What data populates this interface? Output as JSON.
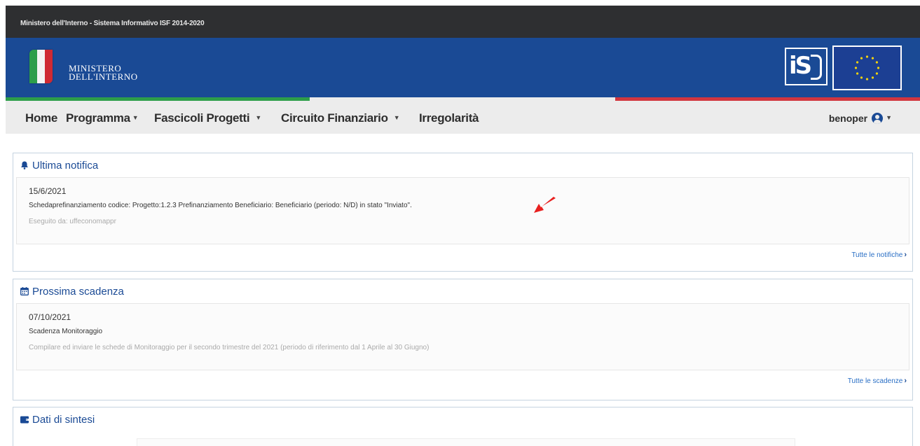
{
  "topbar": {
    "title": "Ministero dell'Interno - Sistema Informativo ISF 2014-2020"
  },
  "header": {
    "ministry_line1": "MINISTERO",
    "ministry_line2": "DELL'INTERNO",
    "isf_logo_text": "iS"
  },
  "nav": {
    "items": [
      "Home",
      "Programma",
      "Fascicoli",
      "Progetti",
      "Circuito Finanziario",
      "Irregolarità"
    ],
    "user": "benoper"
  },
  "cards": {
    "notifica": {
      "title": "Ultima notifica",
      "date": "15/6/2021",
      "text": "Schedaprefinanziamento codice: Progetto:1.2.3 Prefinanziamento Beneficiario: Beneficiario (periodo: N/D) in stato \"Inviato\".",
      "sub": "Eseguito da: uffeconomappr",
      "link": "Tutte le notifiche"
    },
    "scadenza": {
      "title": "Prossima scadenza",
      "date": "07/10/2021",
      "text": "Scadenza Monitoraggio",
      "sub": "Compilare ed inviare le schede di Monitoraggio per il secondo trimestre del 2021 (periodo di riferimento dal 1 Aprile al 30 Giugno)",
      "link": "Tutte le scadenze"
    },
    "sintesi": {
      "title": "Dati di sintesi"
    }
  },
  "colors": {
    "brand_blue": "#1a4a95",
    "topbar_dark": "#2e2f31",
    "italy_green": "#2d9e4a",
    "italy_red": "#d1363f",
    "annotation_arrow": "#e8201f"
  },
  "icons": {
    "notifica": "bell-icon",
    "scadenza": "calendar-icon",
    "sintesi": "wallet-icon",
    "user": "user-circle-icon",
    "link_chevron": "chevron-right-icon",
    "nav_caret": "caret-down-icon"
  }
}
